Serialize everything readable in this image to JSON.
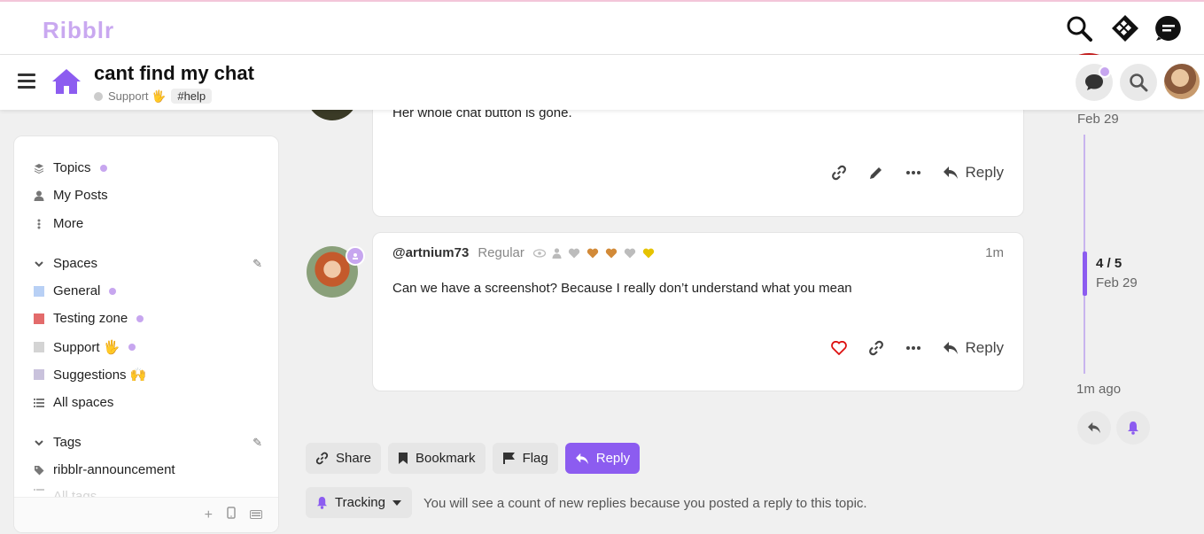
{
  "site": {
    "logo": "Ribblr"
  },
  "topic": {
    "title": "cant find my chat",
    "category": "Support 🖐",
    "tag": "#help"
  },
  "sidebar": {
    "nav": [
      {
        "label": "Topics",
        "icon": "layers-icon",
        "dot": true
      },
      {
        "label": "My Posts",
        "icon": "user-icon",
        "dot": false
      },
      {
        "label": "More",
        "icon": "vertical-dots-icon",
        "dot": false
      }
    ],
    "spaces_header": "Spaces",
    "spaces": [
      {
        "label": "General",
        "color": "#b8d0f5",
        "dot": true
      },
      {
        "label": "Testing zone",
        "color": "#e36b6b",
        "dot": true
      },
      {
        "label": "Support 🖐",
        "color": "#d4d4d4",
        "dot": true
      },
      {
        "label": "Suggestions 🙌",
        "color": "#c9c2dc",
        "dot": false
      }
    ],
    "all_spaces": "All spaces",
    "tags_header": "Tags",
    "tags": [
      {
        "label": "ribblr-announcement"
      }
    ],
    "all_tags": "All tags"
  },
  "posts": [
    {
      "body": "Her whole chat button is gone.",
      "reply_label": "Reply"
    },
    {
      "username": "@artnium73",
      "title": "Regular",
      "time": "1m",
      "body": "Can we have a screenshot? Because I really don’t understand what you mean",
      "reply_label": "Reply"
    }
  ],
  "timeline": {
    "top_date": "Feb 29",
    "position": "4 / 5",
    "position_date": "Feb 29",
    "bottom": "1m ago"
  },
  "footer_buttons": {
    "share": "Share",
    "bookmark": "Bookmark",
    "flag": "Flag",
    "reply": "Reply"
  },
  "tracking": {
    "label": "Tracking",
    "note": "You will see a count of new replies because you posted a reply to this topic."
  },
  "colors": {
    "accent": "#8c5cf0",
    "logo": "#c9a8f0",
    "highlight_circle": "#c11a1a"
  }
}
